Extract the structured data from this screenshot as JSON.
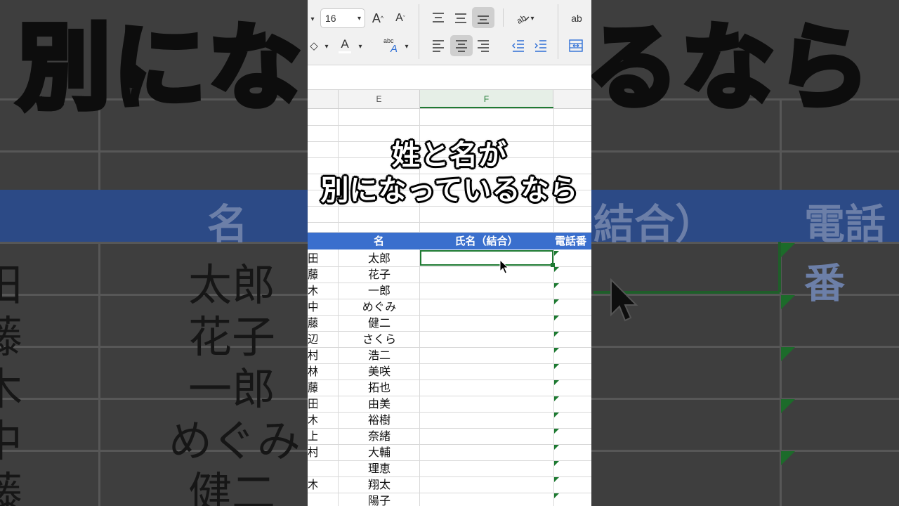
{
  "toolbar": {
    "font_size": "16",
    "increase_font_glyph": "A",
    "decrease_font_glyph": "A",
    "font_color_glyph": "A",
    "abc_glyph": "abc",
    "wrap_glyph": "ab"
  },
  "columns": {
    "e": "E",
    "f": "F"
  },
  "table_header": {
    "first_name": "名",
    "full_name": "氏名（結合）",
    "phone": "電話番"
  },
  "first_names": [
    "太郎",
    "花子",
    "一郎",
    "めぐみ",
    "健二",
    "さくら",
    "浩二",
    "美咲",
    "拓也",
    "由美",
    "裕樹",
    "奈緒",
    "大輔",
    "理恵",
    "翔太",
    "陽子"
  ],
  "last_name_fragments": [
    "田",
    "藤",
    "木",
    "中",
    "藤",
    "辺",
    "村",
    "林",
    "藤",
    "田",
    "木",
    "上",
    "村",
    "",
    "木",
    ""
  ],
  "caption": {
    "line1": "姓と名が",
    "line2": "別になっているなら"
  },
  "background": {
    "title": "別になっているなら",
    "header_name": "名",
    "header_full": "結合）",
    "header_tel": "電話番",
    "cells": [
      "太郎",
      "花子",
      "一郎",
      "めぐみ",
      "健二"
    ],
    "left_fragments": [
      "田",
      "藤",
      "木",
      "中",
      "藤"
    ]
  },
  "colors": {
    "header_blue": "#3a6fcd",
    "selection_green": "#1e7a32"
  }
}
